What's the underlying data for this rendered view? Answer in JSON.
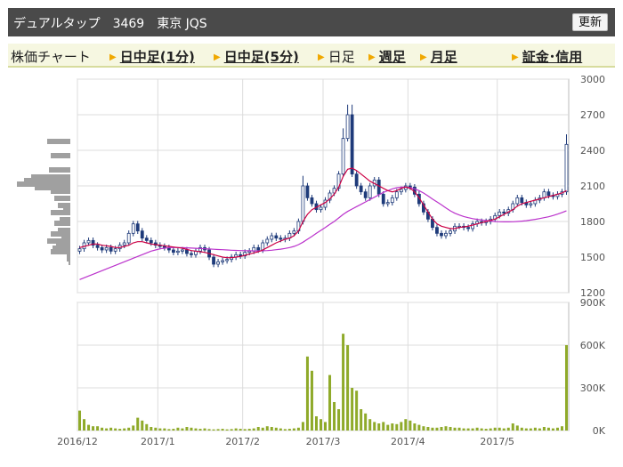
{
  "header": {
    "title": "デュアルタップ　3469　東京 JQS",
    "refresh_label": "更新"
  },
  "nav": {
    "chart_label": "株価チャート",
    "intraday_1": "日中足(1分)",
    "intraday_5": "日中足(5分)",
    "daily": "日足",
    "weekly": "週足",
    "monthly": "月足",
    "margin": "証金･信用"
  },
  "colors": {
    "up_candle": "#ffffff",
    "down_candle": "#1f3b7a",
    "ma_short": "#cc0044",
    "ma_long": "#bb33cc",
    "volume_bar": "#8faa2a",
    "volume_profile": "#a0a0a0",
    "grid": "#dcdcdc"
  },
  "chart_data": [
    {
      "type": "candlestick",
      "ylim": [
        1200,
        3000
      ],
      "yticks": [
        "3000",
        "2700",
        "2400",
        "2100",
        "1800",
        "1500",
        "1200"
      ],
      "xticks": [
        "2016/12",
        "2017/1",
        "2017/2",
        "2017/3",
        "2017/4",
        "2017/5"
      ],
      "close": [
        1570,
        1620,
        1640,
        1600,
        1580,
        1560,
        1580,
        1550,
        1570,
        1600,
        1620,
        1700,
        1780,
        1720,
        1660,
        1640,
        1620,
        1600,
        1590,
        1580,
        1560,
        1540,
        1550,
        1560,
        1530,
        1520,
        1550,
        1580,
        1560,
        1500,
        1440,
        1460,
        1470,
        1480,
        1500,
        1520,
        1510,
        1540,
        1550,
        1580,
        1560,
        1620,
        1650,
        1680,
        1660,
        1650,
        1660,
        1700,
        1720,
        1800,
        2100,
        2000,
        1950,
        1900,
        1920,
        1980,
        2040,
        2080,
        2200,
        2500,
        2700,
        2200,
        2100,
        2050,
        2000,
        2100,
        2150,
        2030,
        1950,
        1960,
        2000,
        2050,
        2070,
        2100,
        2090,
        2030,
        1950,
        1880,
        1820,
        1750,
        1700,
        1680,
        1700,
        1720,
        1760,
        1760,
        1750,
        1740,
        1780,
        1800,
        1790,
        1800,
        1820,
        1850,
        1880,
        1870,
        1900,
        1950,
        2000,
        1960,
        1940,
        1950,
        1980,
        2000,
        2050,
        2020,
        2010,
        2030,
        2050,
        2450
      ],
      "ma_short": [
        1580,
        1590,
        1600,
        1610,
        1610,
        1600,
        1595,
        1590,
        1580,
        1580,
        1590,
        1600,
        1620,
        1630,
        1630,
        1620,
        1610,
        1605,
        1600,
        1595,
        1590,
        1585,
        1580,
        1575,
        1565,
        1555,
        1550,
        1545,
        1540,
        1530,
        1520,
        1510,
        1500,
        1495,
        1495,
        1500,
        1505,
        1515,
        1525,
        1535,
        1545,
        1560,
        1580,
        1600,
        1620,
        1635,
        1650,
        1660,
        1680,
        1720,
        1800,
        1860,
        1900,
        1920,
        1940,
        1960,
        1990,
        2030,
        2090,
        2180,
        2240,
        2250,
        2230,
        2200,
        2170,
        2140,
        2120,
        2100,
        2080,
        2060,
        2050,
        2060,
        2080,
        2090,
        2080,
        2050,
        2000,
        1940,
        1880,
        1820,
        1780,
        1760,
        1750,
        1740,
        1740,
        1750,
        1755,
        1760,
        1770,
        1780,
        1790,
        1800,
        1810,
        1820,
        1840,
        1860,
        1880,
        1900,
        1930,
        1950,
        1960,
        1970,
        1980,
        1990,
        2000,
        2010,
        2020,
        2030,
        2040,
        2060
      ],
      "ma_long": [
        1310,
        1325,
        1340,
        1355,
        1370,
        1385,
        1400,
        1415,
        1430,
        1445,
        1460,
        1475,
        1490,
        1505,
        1520,
        1535,
        1550,
        1560,
        1570,
        1575,
        1580,
        1580,
        1580,
        1580,
        1578,
        1576,
        1574,
        1572,
        1570,
        1568,
        1566,
        1564,
        1562,
        1560,
        1558,
        1556,
        1555,
        1554,
        1553,
        1552,
        1552,
        1553,
        1555,
        1558,
        1562,
        1567,
        1573,
        1580,
        1590,
        1605,
        1625,
        1650,
        1675,
        1700,
        1725,
        1750,
        1775,
        1800,
        1830,
        1860,
        1885,
        1905,
        1925,
        1945,
        1965,
        1985,
        2005,
        2025,
        2045,
        2060,
        2075,
        2085,
        2090,
        2090,
        2085,
        2075,
        2060,
        2040,
        2015,
        1990,
        1965,
        1940,
        1915,
        1890,
        1870,
        1855,
        1842,
        1832,
        1824,
        1818,
        1812,
        1808,
        1804,
        1800,
        1798,
        1797,
        1797,
        1798,
        1800,
        1803,
        1807,
        1812,
        1818,
        1825,
        1832,
        1840,
        1850,
        1862,
        1876,
        1890
      ],
      "volume_profile": [
        {
          "price": 2475,
          "volume": 26
        },
        {
          "price": 2355,
          "volume": 22
        },
        {
          "price": 2235,
          "volume": 24
        },
        {
          "price": 2175,
          "volume": 44
        },
        {
          "price": 2145,
          "volume": 52
        },
        {
          "price": 2115,
          "volume": 60
        },
        {
          "price": 2085,
          "volume": 40
        },
        {
          "price": 2055,
          "volume": 22
        },
        {
          "price": 1995,
          "volume": 18
        },
        {
          "price": 1935,
          "volume": 14
        },
        {
          "price": 1905,
          "volume": 8
        },
        {
          "price": 1875,
          "volume": 22
        },
        {
          "price": 1815,
          "volume": 12
        },
        {
          "price": 1785,
          "volume": 18
        },
        {
          "price": 1725,
          "volume": 14
        },
        {
          "price": 1695,
          "volume": 22
        },
        {
          "price": 1665,
          "volume": 10
        },
        {
          "price": 1635,
          "volume": 26
        },
        {
          "price": 1605,
          "volume": 16
        },
        {
          "price": 1575,
          "volume": 20
        },
        {
          "price": 1545,
          "volume": 22
        },
        {
          "price": 1515,
          "volume": 4
        },
        {
          "price": 1485,
          "volume": 4
        },
        {
          "price": 1455,
          "volume": 2
        }
      ]
    },
    {
      "type": "bar",
      "ylim": [
        0,
        900000
      ],
      "yticks": [
        "900K",
        "600K",
        "300K",
        "0K"
      ],
      "xticks": [
        "2016/12",
        "2017/1",
        "2017/2",
        "2017/3",
        "2017/4",
        "2017/5"
      ],
      "values": [
        140000,
        80000,
        40000,
        30000,
        30000,
        20000,
        15000,
        20000,
        15000,
        12000,
        15000,
        20000,
        35000,
        90000,
        70000,
        45000,
        25000,
        20000,
        15000,
        15000,
        10000,
        12000,
        20000,
        15000,
        25000,
        20000,
        15000,
        12000,
        15000,
        10000,
        8000,
        10000,
        12000,
        8000,
        10000,
        15000,
        12000,
        10000,
        12000,
        15000,
        25000,
        20000,
        30000,
        25000,
        20000,
        15000,
        10000,
        12000,
        15000,
        20000,
        60000,
        520000,
        420000,
        100000,
        80000,
        60000,
        390000,
        200000,
        150000,
        680000,
        600000,
        300000,
        280000,
        150000,
        120000,
        80000,
        60000,
        50000,
        60000,
        40000,
        50000,
        45000,
        60000,
        80000,
        70000,
        50000,
        40000,
        30000,
        25000,
        20000,
        20000,
        25000,
        30000,
        25000,
        20000,
        20000,
        15000,
        15000,
        15000,
        20000,
        15000,
        12000,
        15000,
        20000,
        20000,
        15000,
        20000,
        50000,
        35000,
        20000,
        15000,
        15000,
        20000,
        15000,
        25000,
        20000,
        15000,
        20000,
        30000,
        600000
      ]
    }
  ]
}
